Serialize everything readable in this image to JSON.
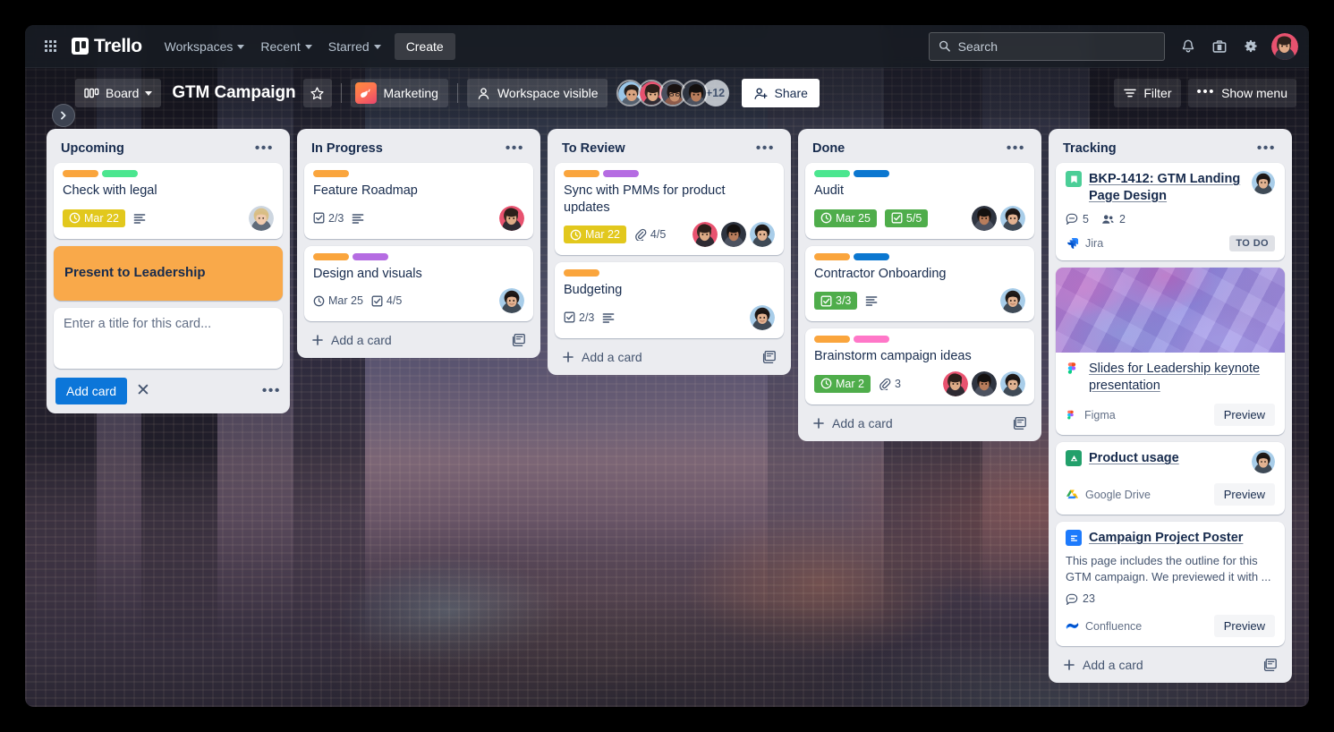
{
  "topnav": {
    "apps_icon": "grid-apps-icon",
    "brand": "Trello",
    "items": [
      {
        "label": "Workspaces",
        "caret": true
      },
      {
        "label": "Recent",
        "caret": true
      },
      {
        "label": "Starred",
        "caret": true
      }
    ],
    "create_label": "Create",
    "search": {
      "placeholder": "Search",
      "value": "",
      "icon": "search-icon"
    },
    "right_icons": [
      "bell-icon",
      "briefcase-icon",
      "gear-icon",
      "user-avatar"
    ]
  },
  "board_header": {
    "sidebar_toggle_icon": "chevron-right-icon",
    "view_label": "Board",
    "view_icon": "board-view-icon",
    "title": "GTM Campaign",
    "star_icon": "star-icon",
    "workspace_chip": {
      "label": "Marketing",
      "logo": "marketing-workspace-logo"
    },
    "visibility": {
      "label": "Workspace visible",
      "icon": "people-icon"
    },
    "members_overflow": "+12",
    "share": {
      "label": "Share",
      "icon": "person-add-icon"
    },
    "filter": {
      "label": "Filter",
      "icon": "filter-icon"
    },
    "show_menu": {
      "label": "Show menu",
      "icon": "ellipsis-icon"
    }
  },
  "colors": {
    "label_orange": "#faa53d",
    "label_green": "#4be68f",
    "label_purple": "#b56ce2",
    "label_blue": "#0b77d0",
    "label_pink": "#ff77c8",
    "due_yellow": "#e2c81d",
    "due_green": "#4fad4b",
    "primary_blue": "#0c76d9",
    "list_bg": "#ebecf0",
    "cover_orange": "#f9a94a"
  },
  "lists": [
    {
      "title": "Upcoming",
      "menu_icon": "list-actions-icon",
      "cards": [
        {
          "kind": "standard",
          "title": "Check with legal",
          "labels": [
            "#faa53d",
            "#4be68f"
          ],
          "badges": [
            {
              "type": "due",
              "tone": "yellow",
              "icon": "clock-icon",
              "text": "Mar 22"
            },
            {
              "type": "description",
              "icon": "description-icon",
              "text": ""
            }
          ],
          "members": 1
        },
        {
          "kind": "cover-color",
          "title": "Present to Leadership",
          "cover": "#f9a94a",
          "labels": [],
          "badges": [],
          "members": 0
        }
      ],
      "composer": {
        "placeholder": "Enter a title for this card...",
        "value": "",
        "add_label": "Add card",
        "close_icon": "close-icon",
        "more_icon": "ellipsis-icon"
      },
      "footer": null
    },
    {
      "title": "In Progress",
      "menu_icon": "list-actions-icon",
      "cards": [
        {
          "kind": "standard",
          "title": "Feature Roadmap",
          "labels": [
            "#faa53d"
          ],
          "badges": [
            {
              "type": "checklist",
              "tone": "plain",
              "icon": "checklist-icon",
              "text": "2/3"
            },
            {
              "type": "description",
              "icon": "description-icon",
              "text": ""
            }
          ],
          "members": 1
        },
        {
          "kind": "standard",
          "title": "Design and visuals",
          "labels": [
            "#faa53d",
            "#b56ce2"
          ],
          "badges": [
            {
              "type": "due",
              "tone": "plain",
              "icon": "clock-icon",
              "text": "Mar 25"
            },
            {
              "type": "checklist",
              "tone": "plain",
              "icon": "checklist-icon",
              "text": "4/5"
            }
          ],
          "members": 1
        }
      ],
      "composer": null,
      "footer": {
        "label": "Add a card",
        "plus_icon": "plus-icon",
        "template_icon": "card-template-icon"
      }
    },
    {
      "title": "To Review",
      "menu_icon": "list-actions-icon",
      "cards": [
        {
          "kind": "standard",
          "title": "Sync with PMMs for product updates",
          "labels": [
            "#faa53d",
            "#b56ce2"
          ],
          "badges": [
            {
              "type": "due",
              "tone": "yellow",
              "icon": "clock-icon",
              "text": "Mar 22"
            },
            {
              "type": "attachment",
              "tone": "plain",
              "icon": "attachment-icon",
              "text": "4/5"
            }
          ],
          "members": 3
        },
        {
          "kind": "standard",
          "title": "Budgeting",
          "labels": [
            "#faa53d"
          ],
          "badges": [
            {
              "type": "checklist",
              "tone": "plain",
              "icon": "checklist-icon",
              "text": "2/3"
            },
            {
              "type": "description",
              "icon": "description-icon",
              "text": ""
            }
          ],
          "members": 1
        }
      ],
      "composer": null,
      "footer": {
        "label": "Add a card",
        "plus_icon": "plus-icon",
        "template_icon": "card-template-icon"
      }
    },
    {
      "title": "Done",
      "menu_icon": "list-actions-icon",
      "cards": [
        {
          "kind": "standard",
          "title": "Audit",
          "labels": [
            "#4be68f",
            "#0b77d0"
          ],
          "badges": [
            {
              "type": "due",
              "tone": "green",
              "icon": "clock-icon",
              "text": "Mar 25"
            },
            {
              "type": "checklist",
              "tone": "green",
              "icon": "checklist-icon",
              "text": "5/5"
            }
          ],
          "members": 2
        },
        {
          "kind": "standard",
          "title": "Contractor Onboarding",
          "labels": [
            "#faa53d",
            "#0b77d0"
          ],
          "badges": [
            {
              "type": "checklist",
              "tone": "green",
              "icon": "checklist-icon",
              "text": "3/3"
            },
            {
              "type": "description",
              "icon": "description-icon",
              "text": ""
            }
          ],
          "members": 1
        },
        {
          "kind": "standard",
          "title": "Brainstorm campaign ideas",
          "labels": [
            "#faa53d",
            "#ff77c8"
          ],
          "badges": [
            {
              "type": "due",
              "tone": "green",
              "icon": "clock-icon",
              "text": "Mar 2"
            },
            {
              "type": "attachment",
              "tone": "plain",
              "icon": "attachment-icon",
              "text": "3"
            }
          ],
          "members": 3
        }
      ],
      "composer": null,
      "footer": {
        "label": "Add a card",
        "plus_icon": "plus-icon",
        "template_icon": "card-template-icon"
      }
    },
    {
      "title": "Tracking",
      "menu_icon": "list-actions-icon",
      "smart_cards": [
        {
          "icon": "jira-issue-icon",
          "title": "BKP-1412: GTM Landing Page Design",
          "has_cover": false,
          "has_member": true,
          "stats": [
            {
              "icon": "comment-icon",
              "text": "5"
            },
            {
              "icon": "people-icon",
              "text": "2"
            }
          ],
          "provider": {
            "name": "Jira",
            "icon": "jira-icon"
          },
          "status": "TO DO",
          "preview": null,
          "description": null
        },
        {
          "icon": "figma-icon",
          "title": "Slides for Leadership keynote presentation",
          "has_cover": true,
          "has_member": false,
          "stats": [],
          "provider": {
            "name": "Figma",
            "icon": "figma-icon"
          },
          "status": null,
          "preview": "Preview",
          "description": null
        },
        {
          "icon": "google-drive-badge-icon",
          "title": "Product usage",
          "has_cover": false,
          "has_member": true,
          "stats": [],
          "provider": {
            "name": "Google Drive",
            "icon": "google-drive-icon"
          },
          "status": null,
          "preview": "Preview",
          "description": null
        },
        {
          "icon": "confluence-page-icon",
          "title": "Campaign Project Poster",
          "has_cover": false,
          "has_member": false,
          "stats": [
            {
              "icon": "comment-icon",
              "text": "23"
            }
          ],
          "provider": {
            "name": "Confluence",
            "icon": "confluence-icon"
          },
          "status": null,
          "preview": "Preview",
          "description": "This page includes the outline for this GTM campaign. We previewed it with ..."
        }
      ],
      "footer": {
        "label": "Add a card",
        "plus_icon": "plus-icon",
        "template_icon": "card-template-icon"
      }
    }
  ]
}
